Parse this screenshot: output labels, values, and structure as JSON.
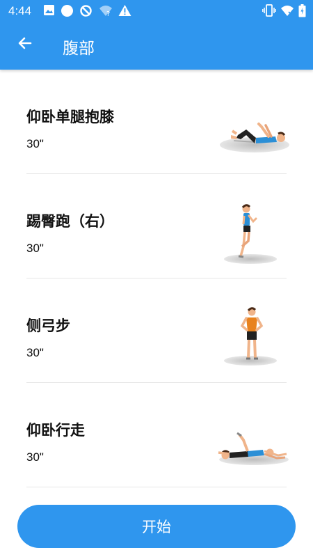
{
  "status_bar": {
    "time": "4:44",
    "icons": [
      "image-icon",
      "circle-icon",
      "sync-off-icon",
      "wifi-unknown-icon",
      "warning-icon",
      "vibrate-icon",
      "wifi-off-icon",
      "battery-icon"
    ]
  },
  "app_bar": {
    "title": "腹部",
    "back_icon": "arrow-back-icon"
  },
  "exercises": [
    {
      "name": "仰卧单腿抱膝",
      "duration": "30\""
    },
    {
      "name": "踢臀跑（右）",
      "duration": "30\""
    },
    {
      "name": "侧弓步",
      "duration": "30\""
    },
    {
      "name": "仰卧行走",
      "duration": "30\""
    }
  ],
  "start_button": {
    "label": "开始"
  },
  "colors": {
    "primary": "#2f96ee",
    "text": "#111111",
    "divider": "#e6e6e6"
  }
}
